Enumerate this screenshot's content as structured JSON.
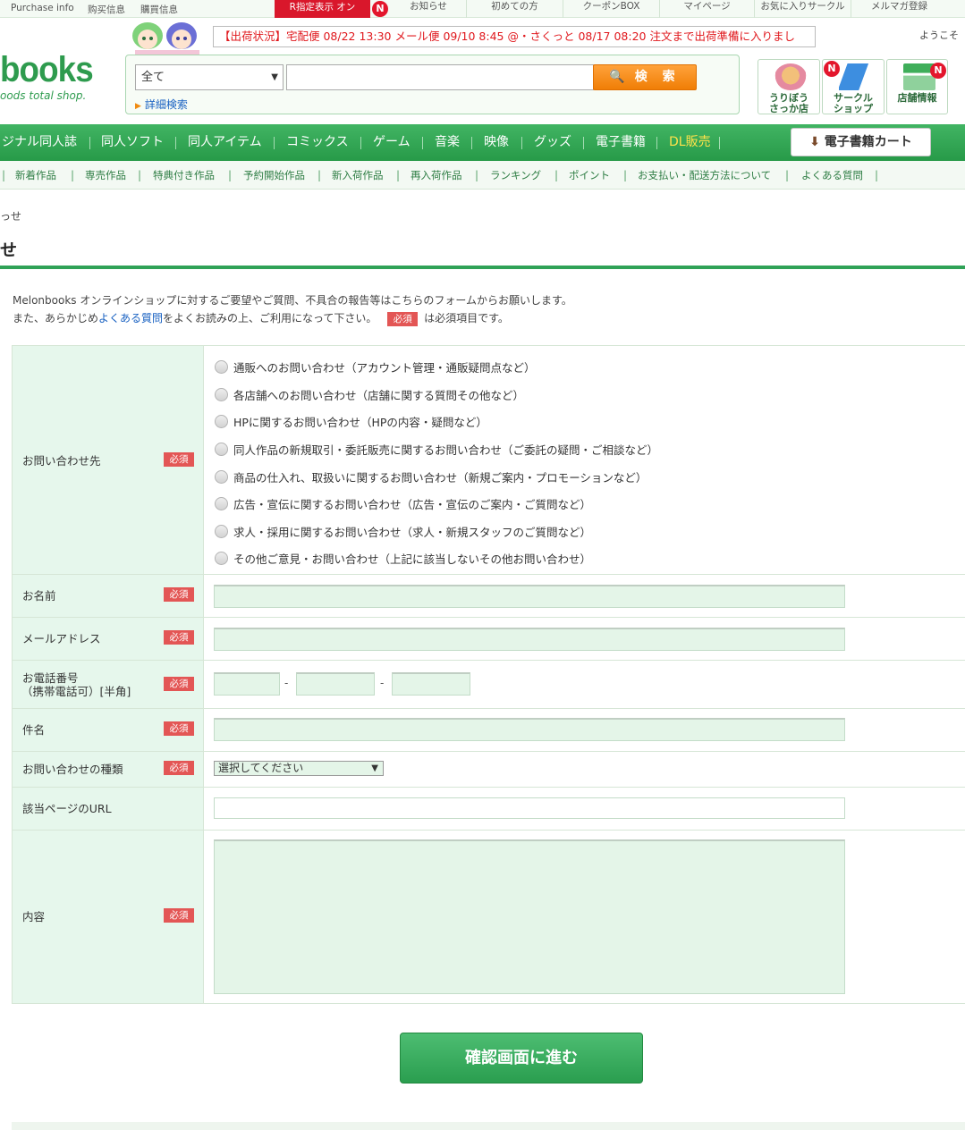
{
  "topbar": {
    "purchase_info": "Purchase info",
    "purchase_info_cn1": "购买信息",
    "purchase_info_cn2": "購買信息",
    "r18_toggle": "R指定表示 オン",
    "nav": [
      "お知らせ",
      "初めての方",
      "クーポンBOX",
      "マイページ",
      "お気に入りサークル",
      "メルマガ登録"
    ],
    "new_badge": "N"
  },
  "header": {
    "logo": "books",
    "logo_sub": "oods total shop.",
    "shipping_status": "【出荷状況】宅配便 08/22 13:30 メール便 09/10 8:45 @・さくっと 08/17 08:20 注文まで出荷準備に入りまし",
    "welcome": "ようこそ"
  },
  "search": {
    "category": "全て",
    "placeholder": "",
    "button": "検 索",
    "advanced": "詳細検索"
  },
  "shop_icons": [
    {
      "label": "うりぼう\nさっか店"
    },
    {
      "label": "サークル\nショップ"
    },
    {
      "label": "店舗情報"
    }
  ],
  "main_nav": [
    "ジナル同人誌",
    "同人ソフト",
    "同人アイテム",
    "コミックス",
    "ゲーム",
    "音楽",
    "映像",
    "グッズ",
    "電子書籍",
    "DL販売"
  ],
  "ebook_cart": "電子書籍カート",
  "sub_nav": [
    "新着作品",
    "専売作品",
    "特典付き作品",
    "予約開始作品",
    "新入荷作品",
    "再入荷作品",
    "ランキング",
    "ポイント",
    "お支払い・配送方法について",
    "よくある質問"
  ],
  "breadcrumb": "っせ",
  "page_title": "せ",
  "intro": {
    "line1": "Melonbooks オンラインショップに対するご要望やご質問、不具合の報告等はこちらのフォームからお願いします。",
    "line2_pre": "また、あらかじめ",
    "line2_link": "よくある質問",
    "line2_mid": "をよくお読みの上、ご利用になって下さい。",
    "line2_post": "は必須項目です。"
  },
  "required": "必須",
  "form": {
    "contact_target": {
      "label": "お問い合わせ先",
      "options": [
        "通販へのお問い合わせ（アカウント管理・通販疑問点など）",
        "各店舗へのお問い合わせ（店舗に関する質問その他など）",
        "HPに関するお問い合わせ（HPの内容・疑問など）",
        "同人作品の新規取引・委託販売に関するお問い合わせ（ご委託の疑問・ご相談など）",
        "商品の仕入れ、取扱いに関するお問い合わせ（新規ご案内・プロモーションなど）",
        "広告・宣伝に関するお問い合わせ（広告・宣伝のご案内・ご質問など）",
        "求人・採用に関するお問い合わせ（求人・新規スタッフのご質問など）",
        "その他ご意見・お問い合わせ（上記に該当しないその他お問い合わせ）"
      ]
    },
    "name": {
      "label": "お名前",
      "value": ""
    },
    "email": {
      "label": "メールアドレス",
      "value": ""
    },
    "phone": {
      "label1": "お電話番号",
      "label2": "（携帯電話可）[半角]",
      "sep": "-"
    },
    "subject": {
      "label": "件名",
      "value": ""
    },
    "inquiry_type": {
      "label": "お問い合わせの種類",
      "selected": "選択してください"
    },
    "url": {
      "label": "該当ページのURL",
      "value": ""
    },
    "content": {
      "label": "内容",
      "value": ""
    }
  },
  "submit": "確認画面に進む"
}
